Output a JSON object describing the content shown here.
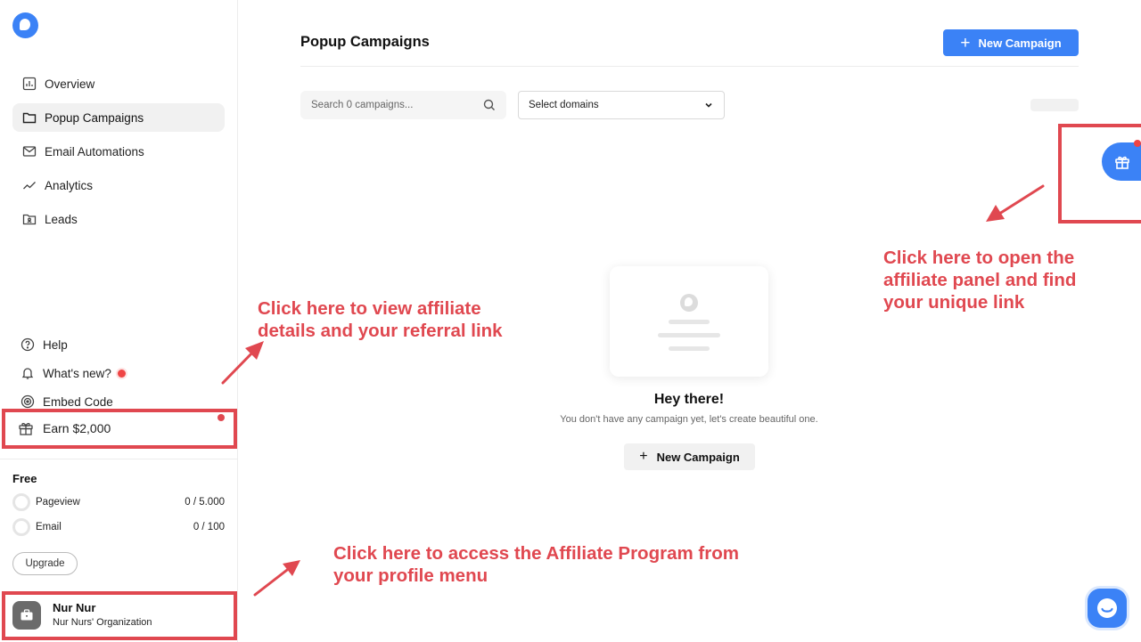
{
  "sidebar": {
    "nav": [
      {
        "label": "Overview",
        "icon": "overview-icon"
      },
      {
        "label": "Popup Campaigns",
        "icon": "folder-icon"
      },
      {
        "label": "Email Automations",
        "icon": "mail-icon"
      },
      {
        "label": "Analytics",
        "icon": "trend-icon"
      },
      {
        "label": "Leads",
        "icon": "leads-folder-icon"
      }
    ],
    "bottom": [
      {
        "label": "Help",
        "icon": "help-icon"
      },
      {
        "label": "What's new?",
        "icon": "bell-icon"
      },
      {
        "label": "Embed Code",
        "icon": "embed-icon"
      }
    ],
    "earn": {
      "label": "Earn $2,000",
      "icon": "gift-icon"
    },
    "plan": {
      "name": "Free",
      "pageview": {
        "label": "Pageview",
        "value": "0 / 5.000"
      },
      "email": {
        "label": "Email",
        "value": "0 / 100"
      },
      "upgrade_label": "Upgrade"
    },
    "profile": {
      "name": "Nur Nur",
      "org": "Nur Nurs' Organization"
    }
  },
  "main": {
    "title": "Popup Campaigns",
    "new_campaign_label": "New Campaign",
    "search_placeholder": "Search 0 campaigns...",
    "domain_select": "Select domains",
    "empty": {
      "title": "Hey there!",
      "subtitle": "You don't have any campaign yet, let's create beautiful one.",
      "button_label": "New Campaign"
    }
  },
  "annotations": {
    "sidebar_earn": "Click here to view affiliate details and your referral link",
    "widget": "Click here to open the affiliate panel and find your unique link",
    "profile": "Click here to access the Affiliate Program from your profile menu"
  },
  "colors": {
    "accent": "#3b82f6",
    "annotation": "#e04850",
    "badge": "#ef4444"
  }
}
